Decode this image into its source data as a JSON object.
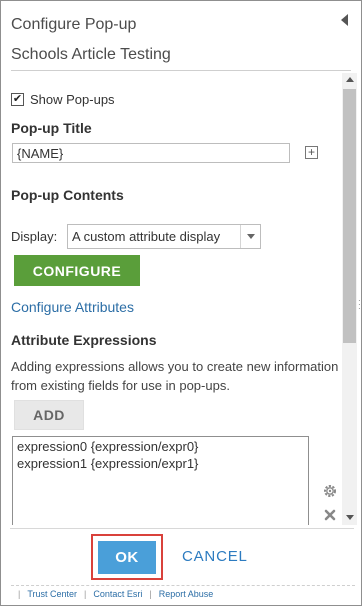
{
  "header": {
    "title": "Configure Pop-up",
    "subtitle": "Schools Article Testing"
  },
  "show_popups": {
    "label": "Show Pop-ups",
    "checked": true,
    "check_glyph": "✔"
  },
  "popup_title": {
    "heading": "Pop-up Title",
    "value": "{NAME}",
    "insert_glyph": "+"
  },
  "popup_contents": {
    "heading": "Pop-up Contents",
    "display_label": "Display:",
    "display_value": "A custom attribute display",
    "configure_label": "CONFIGURE",
    "configure_attributes_link": "Configure Attributes"
  },
  "attribute_expressions": {
    "heading": "Attribute Expressions",
    "description": "Adding expressions allows you to create new information from existing fields for use in pop-ups.",
    "add_label": "ADD",
    "items": [
      "expression0 {expression/expr0}",
      "expression1 {expression/expr1}"
    ]
  },
  "actions": {
    "ok_label": "OK",
    "cancel_label": "CANCEL"
  },
  "footer": {
    "links": [
      "Trust Center",
      "Contact Esri",
      "Report Abuse"
    ],
    "separator": "|"
  },
  "colors": {
    "configure_green": "#5a9e3a",
    "ok_blue": "#4a9fd9",
    "link_blue": "#2c6ea6",
    "highlight_red": "#d9413b"
  },
  "icons": {
    "collapse": "collapse-arrow-icon",
    "settings": "gear-icon",
    "remove": "close-icon",
    "dropdown": "chevron-down-icon"
  }
}
